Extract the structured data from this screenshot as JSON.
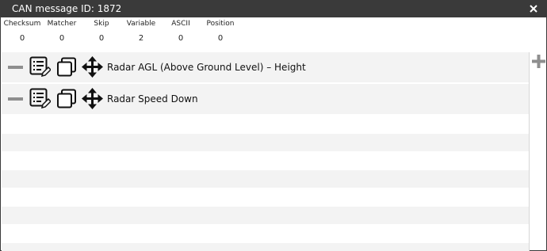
{
  "window": {
    "title": "CAN message ID: 1872",
    "close_icon": "close-x-icon"
  },
  "stats": [
    {
      "label": "Checksum",
      "value": "0"
    },
    {
      "label": "Matcher",
      "value": "0"
    },
    {
      "label": "Skip",
      "value": "0"
    },
    {
      "label": "Variable",
      "value": "2"
    },
    {
      "label": "ASCII",
      "value": "0"
    },
    {
      "label": "Position",
      "value": "0"
    }
  ],
  "rows": [
    {
      "label": "Radar AGL (Above Ground Level) – Height"
    },
    {
      "label": "Radar Speed Down"
    }
  ],
  "icons": {
    "remove": "minus-icon",
    "edit": "edit-list-icon",
    "copy": "copy-icon",
    "move": "move-arrows-icon",
    "add": "plus-icon"
  },
  "colors": {
    "titlebar": "#3a3a3a",
    "row_alt": "#f3f3f3",
    "icon_grey": "#8e8e8e"
  }
}
